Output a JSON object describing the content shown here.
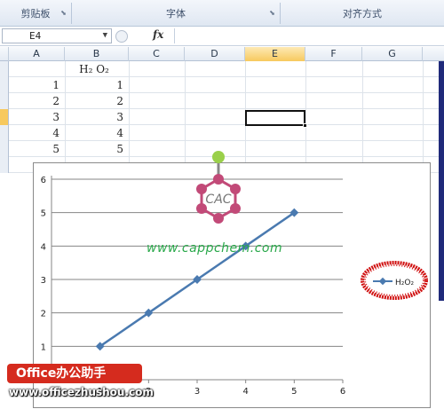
{
  "ribbon": {
    "groups": [
      {
        "label": "剪贴板"
      },
      {
        "label": "字体"
      },
      {
        "label": "对齐方式"
      }
    ]
  },
  "formula_bar": {
    "name_box": "E4",
    "fx_label": "fx",
    "value": ""
  },
  "columns": [
    "A",
    "B",
    "C",
    "D",
    "E",
    "F",
    "G"
  ],
  "active_column": "E",
  "sheet": {
    "header_row": {
      "b_label": "H₂ O₂"
    },
    "rows": [
      {
        "a": "1",
        "b": "1"
      },
      {
        "a": "2",
        "b": "2"
      },
      {
        "a": "3",
        "b": "3"
      },
      {
        "a": "4",
        "b": "4"
      },
      {
        "a": "5",
        "b": "5"
      }
    ],
    "selected_cell": "E4"
  },
  "chart_data": {
    "type": "line",
    "x": [
      1,
      2,
      3,
      4,
      5
    ],
    "series": [
      {
        "name": "H₂O₂",
        "values": [
          1,
          2,
          3,
          4,
          5
        ],
        "color": "#4a7ab0"
      }
    ],
    "xlim": [
      0,
      6
    ],
    "ylim": [
      0,
      6
    ],
    "x_ticks": [
      "1",
      "2",
      "3",
      "4",
      "5",
      "6"
    ],
    "y_ticks": [
      "1",
      "2",
      "3",
      "4",
      "5",
      "6"
    ],
    "grid": "horizontal",
    "legend": "right",
    "title": "",
    "xlabel": "",
    "ylabel": ""
  },
  "watermarks": {
    "center_text": "www.cappchem.com",
    "molecule_label": "CAC",
    "badge_title": "Office办公助手",
    "badge_url": "www.officezhushou.com"
  },
  "colors": {
    "annotation_circle": "#d01010",
    "badge_bg": "#d52b1e",
    "watermark_green": "#29a84a"
  }
}
